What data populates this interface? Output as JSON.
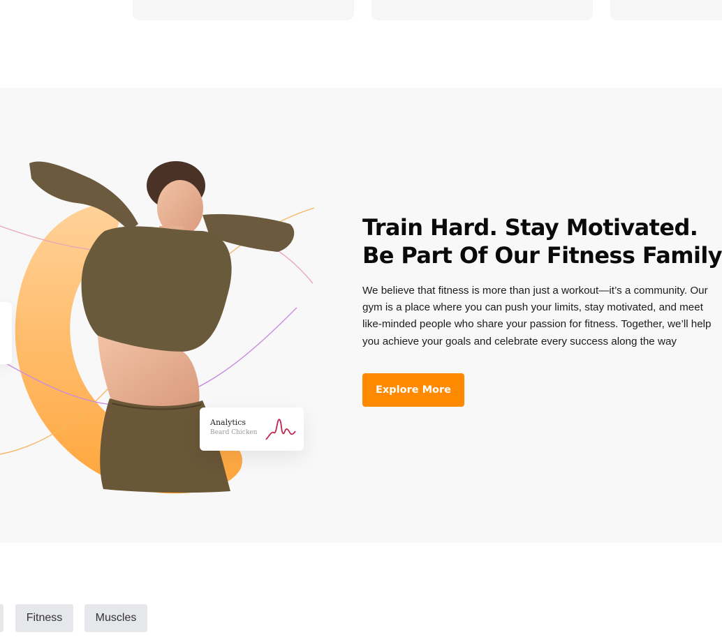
{
  "hero": {
    "headline_line1": "Train Hard. Stay Motivated.",
    "headline_line2": "Be Part Of Our Fitness Family!",
    "body": "We believe that fitness is more than just a workout—it’s a community. Our gym is a place where you can push your limits, stay motivated, and meet like-minded people who share your passion for fitness. Together, we’ll help you achieve your goals and celebrate every success along the way",
    "cta_label": "Explore More"
  },
  "analytics_card": {
    "title": "Analytics",
    "subtitle": "Beard Chicken"
  },
  "tags": [
    {
      "label": ""
    },
    {
      "label": "Fitness"
    },
    {
      "label": "Muscles"
    }
  ],
  "colors": {
    "accent": "#ff8a00",
    "section_bg": "#f8f8f9",
    "tag_bg": "#e6e7ea",
    "sparkline": "#c0264f"
  }
}
